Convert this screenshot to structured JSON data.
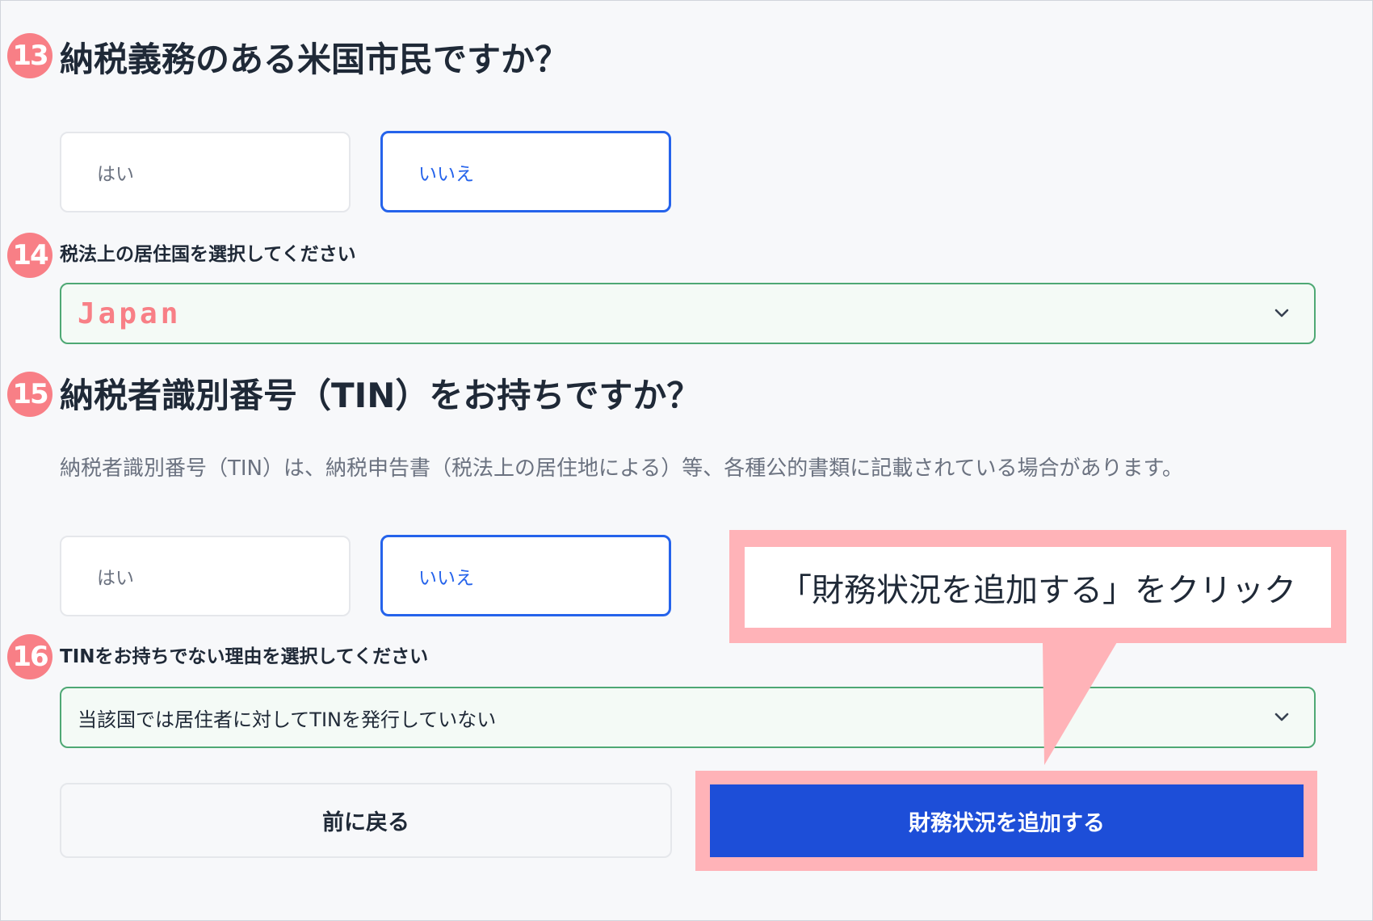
{
  "q13": {
    "number": "13",
    "question": "納税義務のある米国市民ですか？",
    "options": [
      {
        "label": "はい",
        "selected": false
      },
      {
        "label": "いいえ",
        "selected": true
      }
    ]
  },
  "q14": {
    "number": "14",
    "label": "税法上の居住国を選択してください",
    "value": "Japan"
  },
  "q15": {
    "number": "15",
    "question": "納税者識別番号（TIN）をお持ちですか？",
    "description": "納税者識別番号（TIN）は、納税申告書（税法上の居住地による）等、各種公的書類に記載されている場合があります。",
    "options": [
      {
        "label": "はい",
        "selected": false
      },
      {
        "label": "いいえ",
        "selected": true
      }
    ]
  },
  "q16": {
    "number": "16",
    "label": "TINをお持ちでない理由を選択してください",
    "value": "当該国では居住者に対してTINを発行していない"
  },
  "buttons": {
    "back": "前に戻る",
    "add_financial": "財務状況を追加する"
  },
  "callout": {
    "text": "「財務状況を追加する」をクリック"
  },
  "colors": {
    "accent": "#2563eb",
    "primary_button": "#1d4ed8",
    "highlight": "#ffb3b8",
    "step_badge": "#f87f86",
    "select_border": "#4ea874"
  },
  "icons": {
    "select_arrow": "chevron-down-icon"
  }
}
